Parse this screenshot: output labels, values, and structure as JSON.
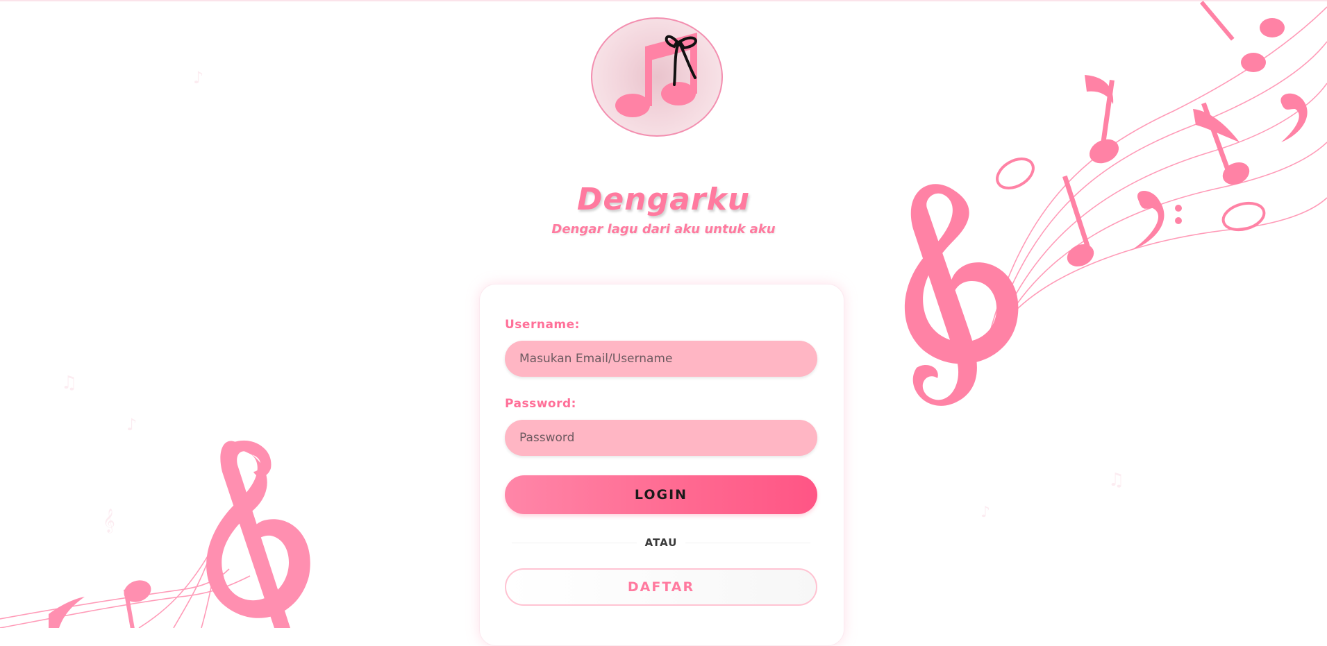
{
  "brand": {
    "title": "Dengarku",
    "subtitle": "Dengar lagu dari aku untuk aku"
  },
  "form": {
    "username_label": "Username:",
    "username_placeholder": "Masukan Email/Username",
    "password_label": "Password:",
    "password_placeholder": "Password",
    "login_label": "LOGIN",
    "divider_label": "ATAU",
    "register_label": "DAFTAR"
  },
  "colors": {
    "accent": "#ff7a9f",
    "input_bg": "#ffb6c4",
    "button_gradient_start": "#ff86a8",
    "button_gradient_end": "#ff5585",
    "note_pink": "#ff82a5"
  },
  "icons": {
    "logo": "music-note-with-bow-icon",
    "decor_top_right": "music-staff-notes-decoration",
    "decor_bottom_left": "treble-clef-staff-decoration"
  }
}
